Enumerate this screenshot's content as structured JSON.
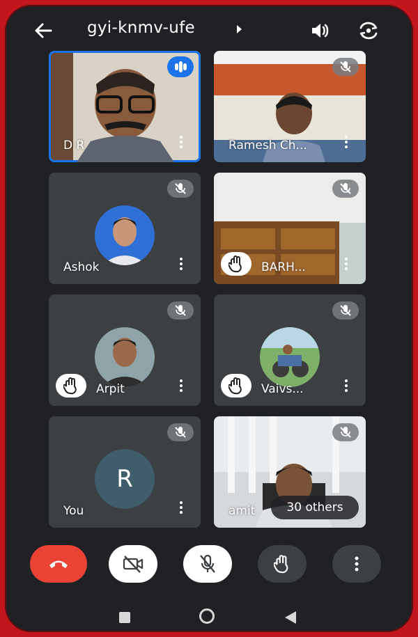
{
  "header": {
    "meeting_code": "gyi-knmv-ufe",
    "icons": [
      "back-arrow-icon",
      "caret-right-icon",
      "speaker-icon",
      "switch-camera-icon"
    ]
  },
  "participants": [
    {
      "name": "D R",
      "state": "speaking",
      "video": true
    },
    {
      "name": "Ramesh Ch...",
      "state": "muted",
      "video": true
    },
    {
      "name": "Ashok",
      "state": "muted",
      "video": false
    },
    {
      "name": "BARH...",
      "state": "muted",
      "video": true,
      "hand_raised": true
    },
    {
      "name": "Arpit",
      "state": "muted",
      "video": false,
      "hand_raised": true
    },
    {
      "name": "Vaivs...",
      "state": "muted",
      "video": false,
      "hand_raised": true
    },
    {
      "name": "You",
      "state": "muted",
      "video": false,
      "avatar_letter": "R"
    },
    {
      "name": "amit",
      "state": "muted",
      "video": true
    }
  ],
  "others_label": "30 others",
  "controls": [
    {
      "id": "end-call",
      "icon": "phone-hangup-icon",
      "color": "#ea4335"
    },
    {
      "id": "camera-off",
      "icon": "camera-off-icon",
      "color": "#ffffff"
    },
    {
      "id": "mic-off",
      "icon": "mic-off-icon",
      "color": "#ffffff"
    },
    {
      "id": "raise-hand",
      "icon": "hand-icon",
      "color": "#3c4043"
    },
    {
      "id": "more-options",
      "icon": "more-vert-icon",
      "color": "#3c4043"
    }
  ],
  "colors": {
    "frame": "#c3161c",
    "background": "#202124",
    "tile": "#3c4043",
    "accent": "#1a73e8"
  }
}
